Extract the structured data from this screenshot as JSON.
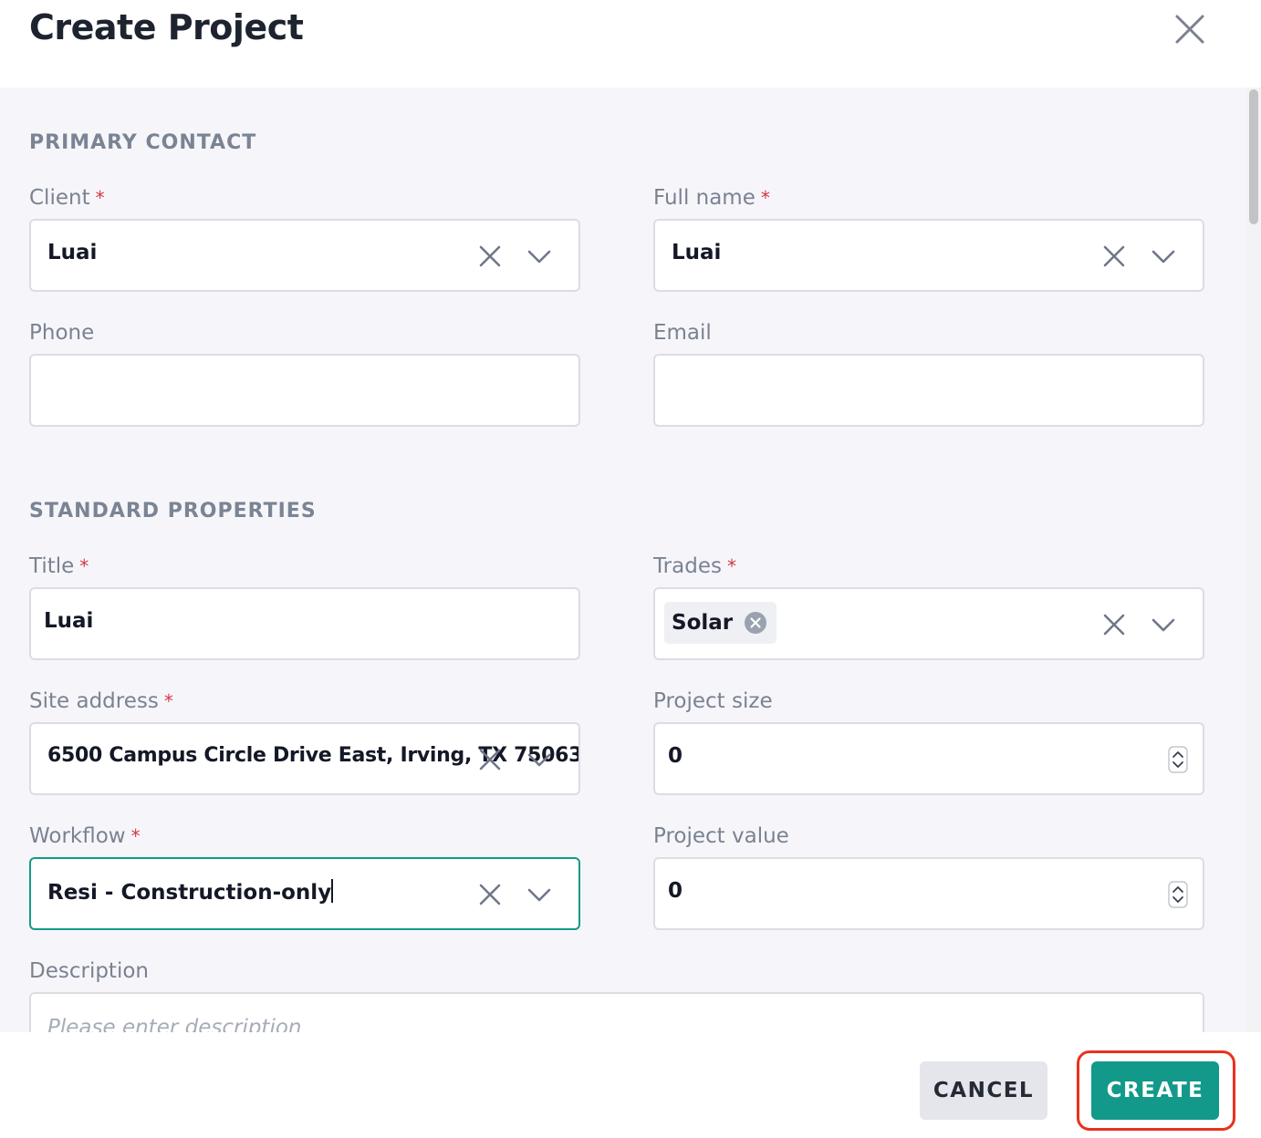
{
  "header": {
    "title": "Create Project"
  },
  "sections": {
    "primary_contact": "PRIMARY CONTACT",
    "standard_properties": "STANDARD PROPERTIES"
  },
  "required_mark": "*",
  "fields": {
    "client": {
      "label": "Client",
      "value": "Luai"
    },
    "full_name": {
      "label": "Full name",
      "value": "Luai"
    },
    "phone": {
      "label": "Phone",
      "value": ""
    },
    "email": {
      "label": "Email",
      "value": ""
    },
    "title": {
      "label": "Title",
      "value": "Luai"
    },
    "trades": {
      "label": "Trades",
      "chips": [
        "Solar"
      ]
    },
    "site_address": {
      "label": "Site address",
      "value": "6500 Campus Circle Drive East, Irving, TX 75063"
    },
    "project_size": {
      "label": "Project size",
      "value": "0"
    },
    "workflow": {
      "label": "Workflow",
      "value": "Resi - Construction-only"
    },
    "project_value": {
      "label": "Project value",
      "value": "0"
    },
    "description": {
      "label": "Description",
      "placeholder": "Please enter description"
    }
  },
  "footer": {
    "cancel_label": "CANCEL",
    "create_label": "CREATE"
  },
  "colors": {
    "accent": "#12998a",
    "required": "#d23a43",
    "highlight": "#e8321e",
    "panel_bg": "#f6f6fa"
  },
  "icons": [
    "close-icon",
    "clear-icon",
    "chevron-down-icon",
    "chip-remove-icon",
    "stepper-icon"
  ]
}
